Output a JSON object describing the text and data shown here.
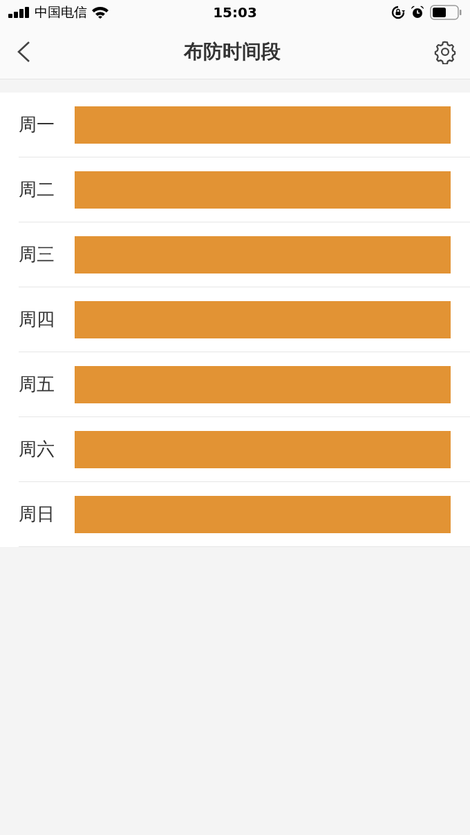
{
  "status_bar": {
    "carrier": "中国电信",
    "time": "15:03"
  },
  "header": {
    "title": "布防时间段"
  },
  "days": [
    {
      "label": "周一",
      "level": 1
    },
    {
      "label": "周二",
      "level": 1
    },
    {
      "label": "周三",
      "level": 1
    },
    {
      "label": "周四",
      "level": 1
    },
    {
      "label": "周五",
      "level": 1
    },
    {
      "label": "周六",
      "level": 1
    },
    {
      "label": "周日",
      "level": 1
    }
  ]
}
